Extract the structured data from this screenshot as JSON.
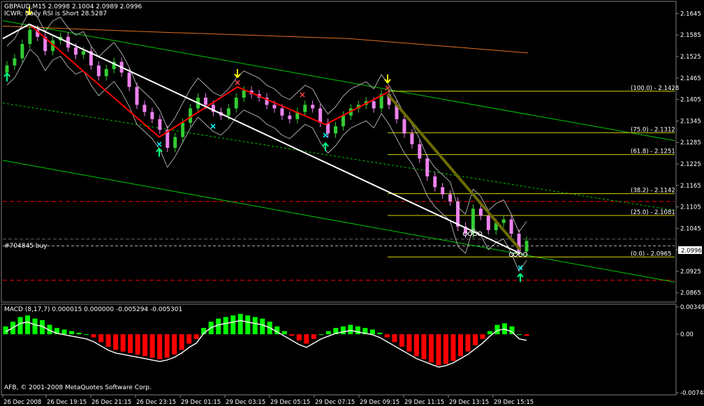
{
  "header": {
    "symbol_line": "GBPAUD,M15  2.0998 2.1004 2.0989 2.0996",
    "indicator_line": "ICWR: Daily RSI is Short 28.5287"
  },
  "order_label": "#704845 buy",
  "current_price_label": "2.0996",
  "copyright": "AFB, © 2001-2008 MetaQuotes Software Corp.",
  "fib_labels": [
    "(100.0) - 2.1428",
    "(75.0) - 2.1312",
    "(61.8) - 2.1251",
    "(38.2) - 2.1142",
    "(25.0) - 2.1081",
    "(0.0) - 2.0965"
  ],
  "colors": {
    "background": "#000000",
    "bull_candle": "#32cd32",
    "bear_candle": "#ee82ee",
    "zigzag": "#ff0000",
    "trendline": "#ffffff",
    "channel": "#00c800",
    "fib": "#d4d400",
    "macd_pos": "#00ff00",
    "macd_neg": "#ff0000"
  },
  "chart_data": [
    {
      "type": "candlestick",
      "title": "GBPAUD,M15",
      "y_ticks": [
        "2.1645",
        "2.1585",
        "2.1525",
        "2.1465",
        "2.1405",
        "2.1345",
        "2.1285",
        "2.1225",
        "2.1165",
        "2.1105",
        "2.1045",
        "2.0985",
        "2.0925",
        "2.0865"
      ],
      "ylim": [
        2.0845,
        2.1675
      ],
      "x_ticks": [
        "26 Dec 2008",
        "26 Dec 19:15",
        "26 Dec 21:15",
        "26 Dec 23:15",
        "29 Dec 01:15",
        "29 Dec 03:15",
        "29 Dec 05:15",
        "29 Dec 07:15",
        "29 Dec 09:15",
        "29 Dec 11:15",
        "29 Dec 13:15",
        "29 Dec 15:15"
      ],
      "last_ohlc": {
        "open": 2.0998,
        "high": 2.1004,
        "low": 2.0989,
        "close": 2.0996
      },
      "fib_levels": [
        2.1428,
        2.1312,
        2.1251,
        2.1142,
        2.1081,
        2.0965
      ],
      "series_close": [
        2.15,
        2.152,
        2.156,
        2.16,
        2.158,
        2.154,
        2.157,
        2.158,
        2.155,
        2.153,
        2.154,
        2.15,
        2.147,
        2.149,
        2.151,
        2.148,
        2.144,
        2.139,
        2.137,
        2.135,
        2.132,
        2.127,
        2.13,
        2.134,
        2.138,
        2.141,
        2.139,
        2.137,
        2.136,
        2.138,
        2.141,
        2.143,
        2.142,
        2.141,
        2.139,
        2.138,
        2.136,
        2.135,
        2.137,
        2.139,
        2.138,
        2.134,
        2.131,
        2.133,
        2.136,
        2.138,
        2.139,
        2.14,
        2.138,
        2.142,
        2.139,
        2.135,
        2.131,
        2.128,
        2.124,
        2.119,
        2.116,
        2.114,
        2.112,
        2.105,
        2.103,
        2.11,
        2.108,
        2.104,
        2.106,
        2.107,
        2.103,
        2.098,
        2.101
      ]
    },
    {
      "type": "bar",
      "title": "MACD",
      "header": "MACD (8,17,7) 0.000015 0.000000 -0.005294 -0.005301",
      "y_ticks": [
        "0.00349",
        "0.00",
        "-0.00748"
      ],
      "ylim": [
        -0.00748,
        0.00349
      ],
      "values": [
        0.001,
        0.0016,
        0.0022,
        0.0024,
        0.002,
        0.0018,
        0.0012,
        0.0008,
        0.0006,
        0.0004,
        0.0002,
        0.0,
        -0.0004,
        -0.001,
        -0.0016,
        -0.002,
        -0.0022,
        -0.0024,
        -0.0026,
        -0.0028,
        -0.003,
        -0.0032,
        -0.003,
        -0.0026,
        -0.002,
        -0.0012,
        -0.0006,
        0.0008,
        0.0016,
        0.002,
        0.0022,
        0.0024,
        0.0026,
        0.0024,
        0.0022,
        0.002,
        0.0016,
        0.001,
        0.0004,
        -0.0002,
        -0.0008,
        -0.0012,
        -0.0006,
        0.0,
        0.0004,
        0.0008,
        0.001,
        0.0012,
        0.001,
        0.0008,
        0.0006,
        0.0002,
        -0.0004,
        -0.001,
        -0.0016,
        -0.0022,
        -0.0028,
        -0.0032,
        -0.0036,
        -0.004,
        -0.0038,
        -0.0034,
        -0.0028,
        -0.0022,
        -0.0014,
        -0.0006,
        0.0004,
        0.0012,
        0.0014,
        0.001,
        0.0,
        -0.0002
      ]
    }
  ]
}
